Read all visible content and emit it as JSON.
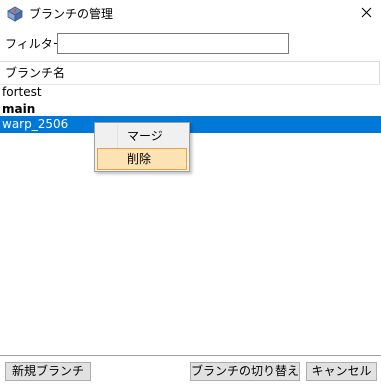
{
  "window": {
    "title": "ブランチの管理",
    "close_glyph": "✕"
  },
  "filter": {
    "label": "フィルター:",
    "value": "",
    "placeholder": ""
  },
  "list": {
    "column_header": "ブランチ名",
    "items": [
      {
        "label": "fortest",
        "bold": false,
        "selected": false
      },
      {
        "label": "main",
        "bold": true,
        "selected": false
      },
      {
        "label": "warp_2506",
        "bold": false,
        "selected": true
      }
    ]
  },
  "context_menu": {
    "items": [
      {
        "label": "マージ",
        "highlighted": false
      },
      {
        "label": "削除",
        "highlighted": true
      }
    ]
  },
  "buttons": {
    "new_branch": "新規ブランチ",
    "switch_branch": "ブランチの切り替え",
    "cancel": "キャンセル"
  },
  "colors": {
    "selection": "#0078d7",
    "menu_highlight": "#fde3b4",
    "menu_highlight_border": "#e5a349"
  }
}
